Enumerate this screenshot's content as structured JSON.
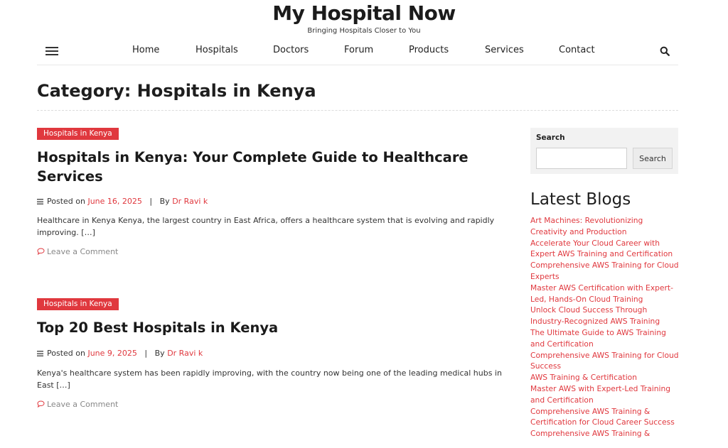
{
  "site": {
    "title": "My Hospital Now",
    "tagline": "Bringing Hospitals Closer to You"
  },
  "nav": {
    "menu_icon": "hamburger-menu-icon",
    "search_icon": "search-icon",
    "items": [
      "Home",
      "Hospitals",
      "Doctors",
      "Forum",
      "Products",
      "Services",
      "Contact"
    ]
  },
  "page": {
    "title": "Category: Hospitals in Kenya"
  },
  "posts": [
    {
      "category": "Hospitals in Kenya",
      "title": "Hospitals in Kenya: Your Complete Guide to Healthcare Services",
      "posted_on": "Posted on",
      "date": "June 16, 2025",
      "by": "By",
      "author": "Dr Ravi k",
      "excerpt": "Healthcare in Kenya Kenya, the largest country in East Africa, offers a healthcare system that is evolving and rapidly improving. […]",
      "comment": "Leave a Comment"
    },
    {
      "category": "Hospitals in Kenya",
      "title": "Top 20 Best Hospitals in Kenya",
      "posted_on": "Posted on",
      "date": "June 9, 2025",
      "by": "By",
      "author": "Dr Ravi k",
      "excerpt": "Kenya's healthcare system has been rapidly improving, with the country now being one of the leading medical hubs in East […]",
      "comment": "Leave a Comment"
    }
  ],
  "sidebar": {
    "search": {
      "label": "Search",
      "button": "Search",
      "value": ""
    },
    "latest_title": "Latest Blogs",
    "blogs": [
      "Art Machines: Revolutionizing Creativity and Production",
      "Accelerate Your Cloud Career with Expert AWS Training and Certification",
      "Comprehensive AWS Training for Cloud Experts",
      "Master AWS Certification with Expert-Led, Hands-On Cloud Training",
      "Unlock Cloud Success Through Industry-Recognized AWS Training",
      "The Ultimate Guide to AWS Training and Certification",
      "Comprehensive AWS Training for Cloud Success",
      "AWS Training & Certification",
      "Master AWS with Expert-Led Training and Certification",
      "Comprehensive AWS Training & Certification for Cloud Career Success",
      "Comprehensive AWS Training &"
    ]
  },
  "colors": {
    "accent": "#e0383e",
    "text": "#333333",
    "sidebar_bg": "#f2f2f2"
  }
}
